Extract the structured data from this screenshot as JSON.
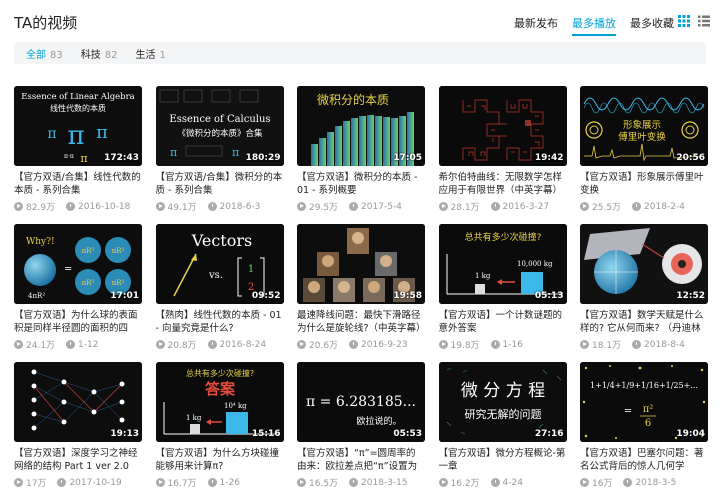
{
  "header": {
    "title": "TA的视频",
    "sort_tabs": [
      "最新发布",
      "最多播放",
      "最多收藏"
    ],
    "active_sort": 1,
    "accent_color": "#00a1d6",
    "view_icons": [
      "grid-view-icon",
      "list-view-icon"
    ]
  },
  "filters": [
    {
      "label": "全部",
      "count": "83"
    },
    {
      "label": "科技",
      "count": "82"
    },
    {
      "label": "生活",
      "count": "1"
    }
  ],
  "videos": [
    {
      "title": "【官方双语/合集】线性代数的本质 - 系列合集",
      "duration": "172:43",
      "views": "82.9万",
      "date": "2016-10-18",
      "thumb_text": [
        "Essence of Linear Algebra",
        "线性代数的本质"
      ]
    },
    {
      "title": "【官方双语/合集】微积分的本质 - 系列合集",
      "duration": "180:29",
      "views": "49.1万",
      "date": "2018-6-3",
      "thumb_text": [
        "Essence of Calculus",
        "《微积分的本质》合集"
      ]
    },
    {
      "title": "【官方双语】微积分的本质 - 01 - 系列概要",
      "duration": "17:05",
      "views": "29.5万",
      "date": "2017-5-4",
      "thumb_text": [
        "微积分的本质"
      ]
    },
    {
      "title": "希尔伯特曲线：无限数学怎样应用于有限世界（中英字幕）",
      "duration": "19:42",
      "views": "28.1万",
      "date": "2016-3-27",
      "thumb_text": []
    },
    {
      "title": "【官方双语】形象展示傅里叶变换",
      "duration": "20:56",
      "views": "25.5万",
      "date": "2018-2-4",
      "thumb_text": [
        "形象展示",
        "傅里叶变换"
      ]
    },
    {
      "title": "【官方双语】为什么球的表面积是同样半径圆的面积的四倍?",
      "duration": "17:01",
      "views": "24.1万",
      "date": "1-12",
      "thumb_text": [
        "Why?!",
        "πR²",
        "4πR²"
      ]
    },
    {
      "title": "【熟肉】线性代数的本质 - 01 - 向量究竟是什么?",
      "duration": "09:52",
      "views": "20.8万",
      "date": "2016-8-24",
      "thumb_text": [
        "Vectors",
        "vs."
      ]
    },
    {
      "title": "最速降线问题：最快下滑路径为什么是旋轮线?（中英字幕）",
      "duration": "19:58",
      "views": "20.6万",
      "date": "2016-9-23",
      "thumb_text": []
    },
    {
      "title": "【官方双语】一个计数谜题的意外答案",
      "duration": "05:13",
      "views": "19.8万",
      "date": "1-16",
      "thumb_text": [
        "总共有多少次碰撞?",
        "1 kg",
        "10,000 kg"
      ]
    },
    {
      "title": "【官方双语】数学天赋是什么样的? 它从何而来? （丹迪林双球）",
      "duration": "12:52",
      "views": "18.1万",
      "date": "2018-8-4",
      "thumb_text": []
    },
    {
      "title": "【官方双语】深度学习之神经网络的结构 Part 1 ver 2.0",
      "duration": "19:13",
      "views": "17万",
      "date": "2017-10-19",
      "thumb_text": []
    },
    {
      "title": "【官方双语】为什么方块碰撞能够用来计算π?",
      "duration": "15:16",
      "views": "16.7万",
      "date": "1-26",
      "thumb_text": [
        "总共有多少次碰撞?",
        "答案",
        "1 kg",
        "10⁴ kg"
      ]
    },
    {
      "title": "【官方双语】“π”=圆周率的由来：欧拉差点把“π”设置为6.283185...",
      "duration": "05:53",
      "views": "16.5万",
      "date": "2018-3-15",
      "thumb_text": [
        "π = 6.283185...",
        "欧拉说的。"
      ]
    },
    {
      "title": "【官方双语】微分方程概论-第一章",
      "duration": "27:16",
      "views": "16.2万",
      "date": "4-24",
      "thumb_text": [
        "微 分 方 程",
        "研究无解的问题"
      ]
    },
    {
      "title": "【官方双语】巴塞尔问题：著名公式背后的惊人几何学",
      "duration": "19:04",
      "views": "16万",
      "date": "2018-3-5",
      "thumb_text": [
        "1+1/4+1/9+1/16+1/25+...",
        "π²",
        "6"
      ]
    }
  ]
}
